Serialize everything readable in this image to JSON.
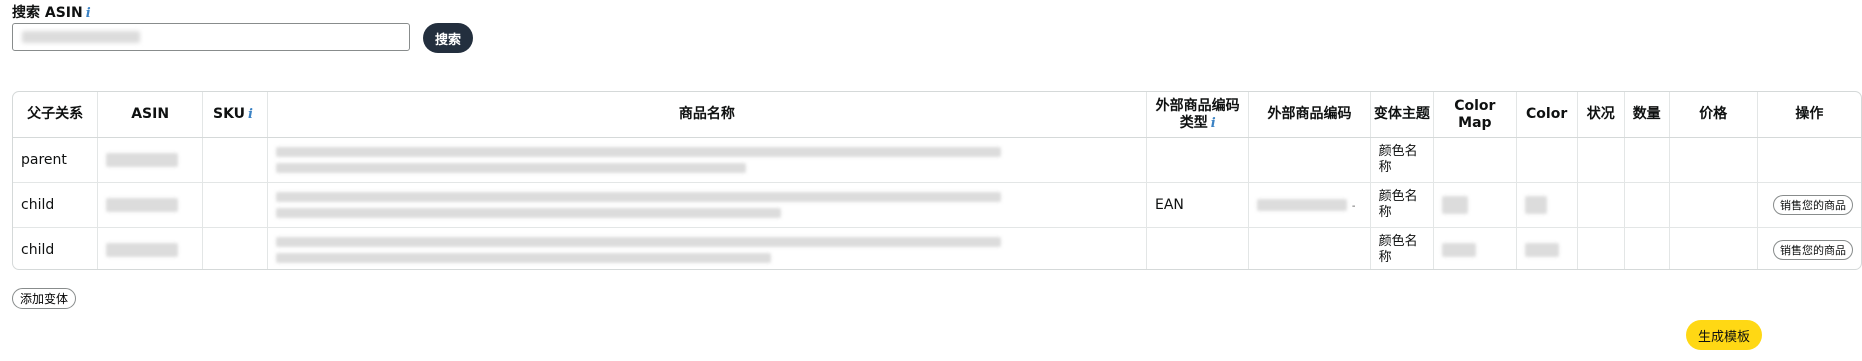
{
  "search": {
    "label": "搜索 ASIN",
    "info_icon": "i",
    "input_value": "",
    "button_label": "搜索"
  },
  "table": {
    "headers": {
      "parent_child": "父子关系",
      "asin": "ASIN",
      "sku": "SKU",
      "product_name": "商品名称",
      "ext_id_type": "外部商品编码类型",
      "ext_id": "外部商品编码",
      "variation_theme": "变体主题",
      "color_map": "Color Map",
      "color": "Color",
      "condition": "状况",
      "quantity": "数量",
      "price": "价格",
      "actions": "操作"
    },
    "rows": [
      {
        "relation": "parent",
        "ext_id_type": "",
        "variation_theme": "颜色名称",
        "action_label": ""
      },
      {
        "relation": "child",
        "ext_id_type": "EAN",
        "ext_id_dash": "-",
        "variation_theme": "颜色名称",
        "action_label": "销售您的商品"
      },
      {
        "relation": "child",
        "ext_id_type": "",
        "variation_theme": "颜色名称",
        "action_label": "销售您的商品"
      }
    ]
  },
  "add_variant_label": "添加变体",
  "generate_template_label": "生成模板",
  "colors": {
    "primary_button": "#232f3e",
    "generate_button": "#ffd814",
    "info_icon": "#3b82c4",
    "redacted": "#d6d6d6"
  }
}
